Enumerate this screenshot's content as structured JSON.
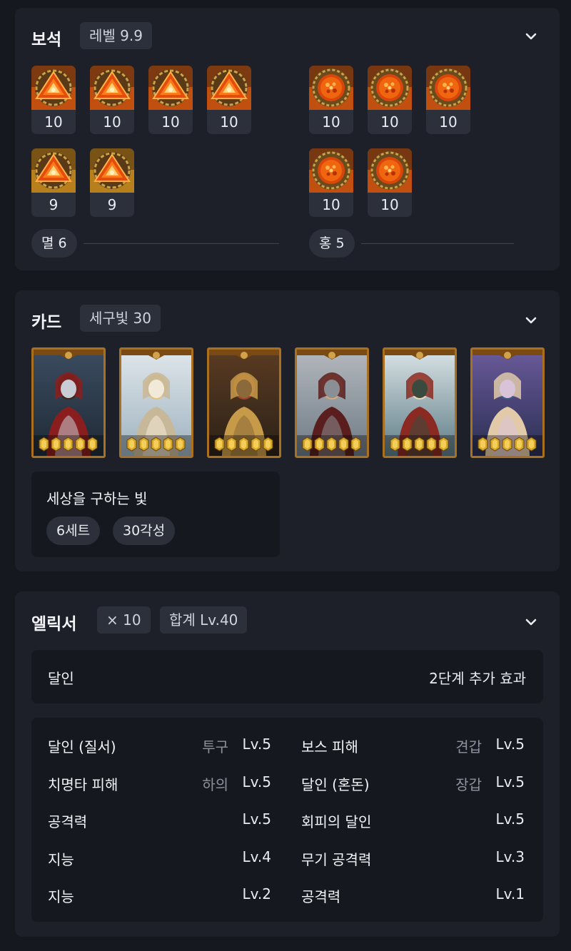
{
  "gems": {
    "title": "보석",
    "level_tag": "레벨 9.9",
    "left_group": [
      {
        "level": "10",
        "type": "orange-triangle",
        "bg": "#c04f10"
      },
      {
        "level": "10",
        "type": "orange-triangle",
        "bg": "#c04f10"
      },
      {
        "level": "10",
        "type": "orange-triangle",
        "bg": "#c04f10"
      },
      {
        "level": "10",
        "type": "orange-triangle",
        "bg": "#c04f10"
      },
      {
        "level": "9",
        "type": "orange-triangle",
        "bg": "#b8801c"
      },
      {
        "level": "9",
        "type": "orange-triangle",
        "bg": "#b8801c"
      }
    ],
    "right_group": [
      {
        "level": "10",
        "type": "red-orb",
        "bg": "#c04f10"
      },
      {
        "level": "10",
        "type": "red-orb",
        "bg": "#c04f10"
      },
      {
        "level": "10",
        "type": "red-orb",
        "bg": "#c04f10"
      },
      {
        "level": "10",
        "type": "red-orb",
        "bg": "#c04f10"
      },
      {
        "level": "10",
        "type": "red-orb",
        "bg": "#c04f10"
      }
    ],
    "left_summary": "멸 6",
    "right_summary": "홍 5"
  },
  "cards": {
    "title": "카드",
    "set_tag": "세구빛 30",
    "items": [
      {
        "portrait": "dark-haired-warrior-moon",
        "awakening": 5
      },
      {
        "portrait": "winged-angel-blonde",
        "awakening": 5
      },
      {
        "portrait": "bearded-dwarf-armor",
        "awakening": 5
      },
      {
        "portrait": "armored-knight",
        "awakening": 5
      },
      {
        "portrait": "elf-mage-forest",
        "awakening": 5
      },
      {
        "portrait": "twin-sorceresses",
        "awakening": 5
      }
    ],
    "set_name": "세상을 구하는 빛",
    "set_count": "6세트",
    "awaken_total": "30각성"
  },
  "elixir": {
    "title": "엘릭서",
    "count_tag": "× 10",
    "total_tag": "합계 Lv.40",
    "bonus_name": "달인",
    "bonus_effect": "2단계 추가 효과",
    "rows": [
      {
        "left": {
          "name": "달인 (질서)",
          "slot": "투구",
          "level": "Lv.5"
        },
        "right": {
          "name": "보스 피해",
          "slot": "견갑",
          "level": "Lv.5"
        }
      },
      {
        "left": {
          "name": "치명타 피해",
          "slot": "하의",
          "level": "Lv.5"
        },
        "right": {
          "name": "달인 (혼돈)",
          "slot": "장갑",
          "level": "Lv.5"
        }
      },
      {
        "left": {
          "name": "공격력",
          "slot": "",
          "level": "Lv.5"
        },
        "right": {
          "name": "회피의 달인",
          "slot": "",
          "level": "Lv.5"
        }
      },
      {
        "left": {
          "name": "지능",
          "slot": "",
          "level": "Lv.4"
        },
        "right": {
          "name": "무기 공격력",
          "slot": "",
          "level": "Lv.3"
        }
      },
      {
        "left": {
          "name": "지능",
          "slot": "",
          "level": "Lv.2"
        },
        "right": {
          "name": "공격력",
          "slot": "",
          "level": "Lv.1"
        }
      }
    ]
  },
  "colors": {
    "page_bg": "#15181e",
    "panel_bg": "#1d2028",
    "tag_bg": "#2b303a",
    "card_border": "#a8701f",
    "gem_orange": "#c04f10",
    "gem_gold": "#b8801c"
  }
}
